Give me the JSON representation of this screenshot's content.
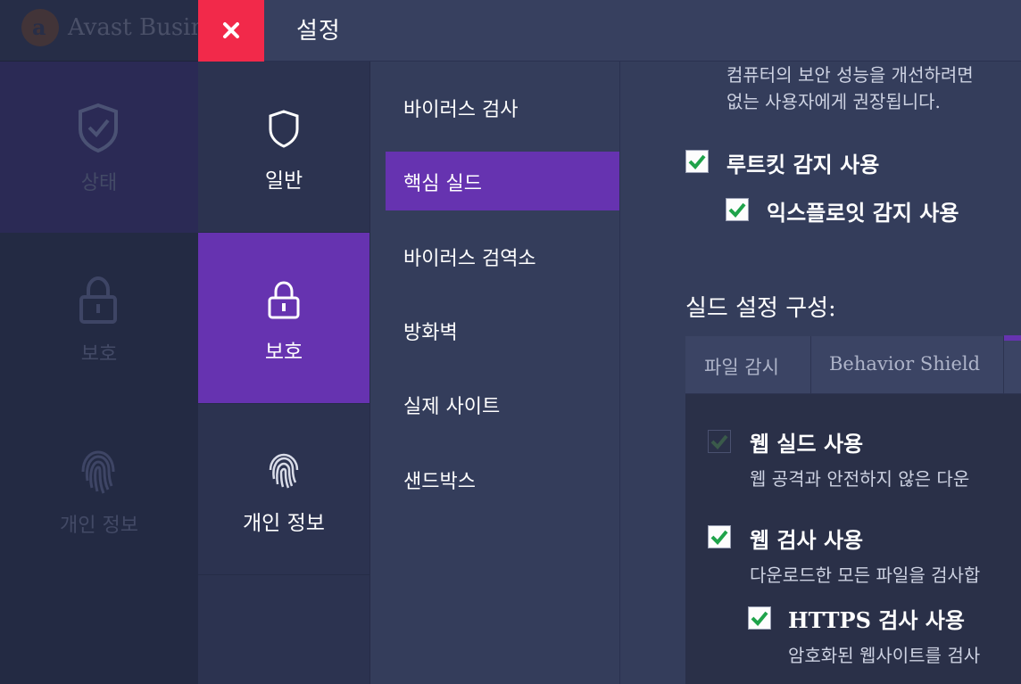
{
  "background_app": {
    "title": "Avast Busin",
    "nav": [
      {
        "label": "상태"
      },
      {
        "label": "보호"
      },
      {
        "label": "개인 정보"
      }
    ]
  },
  "settings": {
    "title": "설정",
    "categories": [
      {
        "label": "일반",
        "icon": "shield-icon"
      },
      {
        "label": "보호",
        "icon": "lock-icon",
        "selected": true
      },
      {
        "label": "개인 정보",
        "icon": "fingerprint-icon"
      }
    ],
    "subnav": [
      {
        "label": "바이러스 검사"
      },
      {
        "label": "핵심 실드",
        "selected": true
      },
      {
        "label": "바이러스 검역소"
      },
      {
        "label": "방화벽"
      },
      {
        "label": "실제 사이트"
      },
      {
        "label": "샌드박스"
      }
    ],
    "content": {
      "intro_line1": "컴퓨터의 보안 성능을 개선하려면",
      "intro_line2": "없는 사용자에게 권장됩니다.",
      "rootkit_label": "루트킷 감지 사용",
      "exploit_label": "익스플로잇 감지 사용",
      "shield_config_title": "실드 설정 구성:",
      "tabs": [
        {
          "label": "파일 감시"
        },
        {
          "label": "Behavior Shield"
        }
      ],
      "web_shield_label": "웹 실드 사용",
      "web_shield_desc": "웹 공격과 안전하지 않은 다운",
      "web_scan_label": "웹 검사 사용",
      "web_scan_desc": "다운로드한 모든 파일을 검사합",
      "https_label": "HTTPS 검사 사용",
      "https_desc": "암호화된 웹사이트를 검사"
    }
  },
  "colors": {
    "accent_purple": "#6633b0",
    "close_red": "#f2294a",
    "check_green": "#1fa34a"
  }
}
